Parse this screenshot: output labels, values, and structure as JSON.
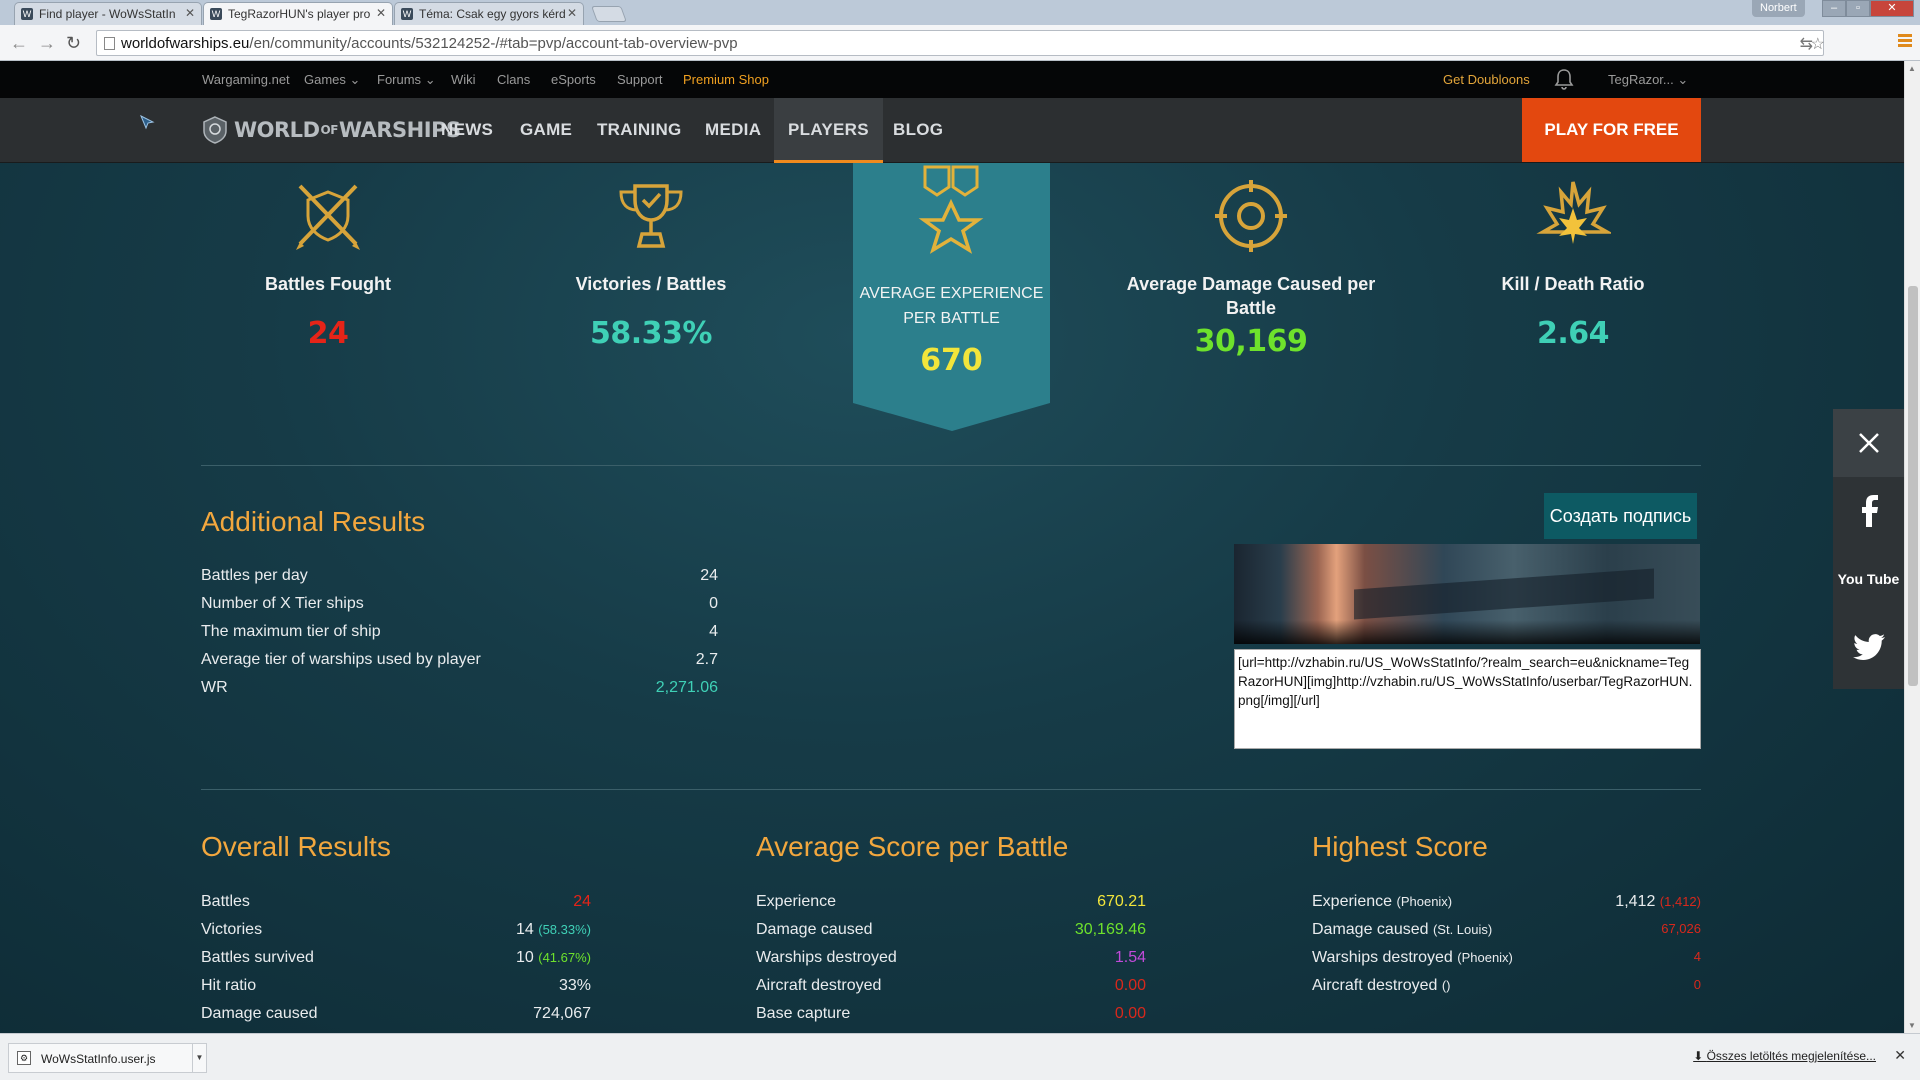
{
  "browser": {
    "tabs": [
      {
        "title": "Find player - WoWsStatIn",
        "active": false
      },
      {
        "title": "TegRazorHUN's player pro",
        "active": true
      },
      {
        "title": "Téma: Csak egy gyors kérd",
        "active": false
      }
    ],
    "window_user": "Norbert",
    "url_host": "worldofwarships.eu",
    "url_path": "/en/community/accounts/532124252-/#tab=pvp/account-tab-overview-pvp",
    "accent": "#e08a1c"
  },
  "topnav": {
    "links": [
      "Wargaming.net",
      "Games",
      "Forums",
      "Wiki",
      "Clans",
      "eSports",
      "Support"
    ],
    "premium": "Premium Shop",
    "doubloons": "Get Doubloons",
    "user": "TegRazor..."
  },
  "mainnav": {
    "logo": {
      "left": "WORLD",
      "mid": "OF",
      "right": "WARSHIPS"
    },
    "items": [
      "NEWS",
      "GAME",
      "TRAINING",
      "MEDIA",
      "PLAYERS",
      "BLOG"
    ],
    "active": "PLAYERS",
    "play": "PLAY FOR FREE",
    "play_color": "#e3480f"
  },
  "stats": {
    "battles": {
      "label": "Battles Fought",
      "value": "24"
    },
    "victories": {
      "label": "Victories / Battles",
      "value": "58.33%"
    },
    "avg_exp": {
      "label": "AVERAGE EXPERIENCE PER BATTLE",
      "value": "670"
    },
    "avg_dmg": {
      "label": "Average Damage Caused per Battle",
      "value": "30,169"
    },
    "kd": {
      "label": "Kill / Death Ratio",
      "value": "2.64"
    }
  },
  "additional": {
    "title": "Additional Results",
    "rows": [
      {
        "k": "Battles per day",
        "v": "24"
      },
      {
        "k": "Number of X Tier ships",
        "v": "0"
      },
      {
        "k": "The maximum tier of ship",
        "v": "4"
      },
      {
        "k": "Average tier of warships used by player",
        "v": "2.7"
      },
      {
        "k": "WR",
        "v": "2,271.06"
      }
    ],
    "signature_button": "Создать подпись",
    "signature_code": "[url=http://vzhabin.ru/US_WoWsStatInfo/?realm_search=eu&nickname=TegRazorHUN][img]http://vzhabin.ru/US_WoWsStatInfo/userbar/TegRazorHUN.png[/img][/url]"
  },
  "overall": {
    "title": "Overall Results",
    "rows": [
      {
        "k": "Battles",
        "v": "24",
        "note": ""
      },
      {
        "k": "Victories",
        "v": "14",
        "note": "(58.33%)"
      },
      {
        "k": "Battles survived",
        "v": "10",
        "note": "(41.67%)"
      },
      {
        "k": "Hit ratio",
        "v": "33%",
        "note": ""
      },
      {
        "k": "Damage caused",
        "v": "724,067",
        "note": ""
      }
    ]
  },
  "average": {
    "title": "Average Score per Battle",
    "rows": [
      {
        "k": "Experience",
        "v": "670.21"
      },
      {
        "k": "Damage caused",
        "v": "30,169.46"
      },
      {
        "k": "Warships destroyed",
        "v": "1.54"
      },
      {
        "k": "Aircraft destroyed",
        "v": "0.00"
      },
      {
        "k": "Base capture",
        "v": "0.00"
      }
    ]
  },
  "highest": {
    "title": "Highest Score",
    "rows": [
      {
        "k": "Experience",
        "ship": "(Phoenix)",
        "v": "1,412",
        "note": "(1,412)"
      },
      {
        "k": "Damage caused",
        "ship": "(St. Louis)",
        "v": "",
        "note": "67,026"
      },
      {
        "k": "Warships destroyed",
        "ship": "(Phoenix)",
        "v": "",
        "note": "4"
      },
      {
        "k": "Aircraft destroyed",
        "ship": "()",
        "v": "",
        "note": "0"
      }
    ]
  },
  "social": {
    "icons": [
      "close-icon",
      "facebook-icon",
      "youtube-icon",
      "twitter-icon"
    ],
    "youtube": "You Tube"
  },
  "downloads": {
    "file": "WoWsStatInfo.user.js",
    "show_all": "Összes letöltés megjelenítése..."
  }
}
